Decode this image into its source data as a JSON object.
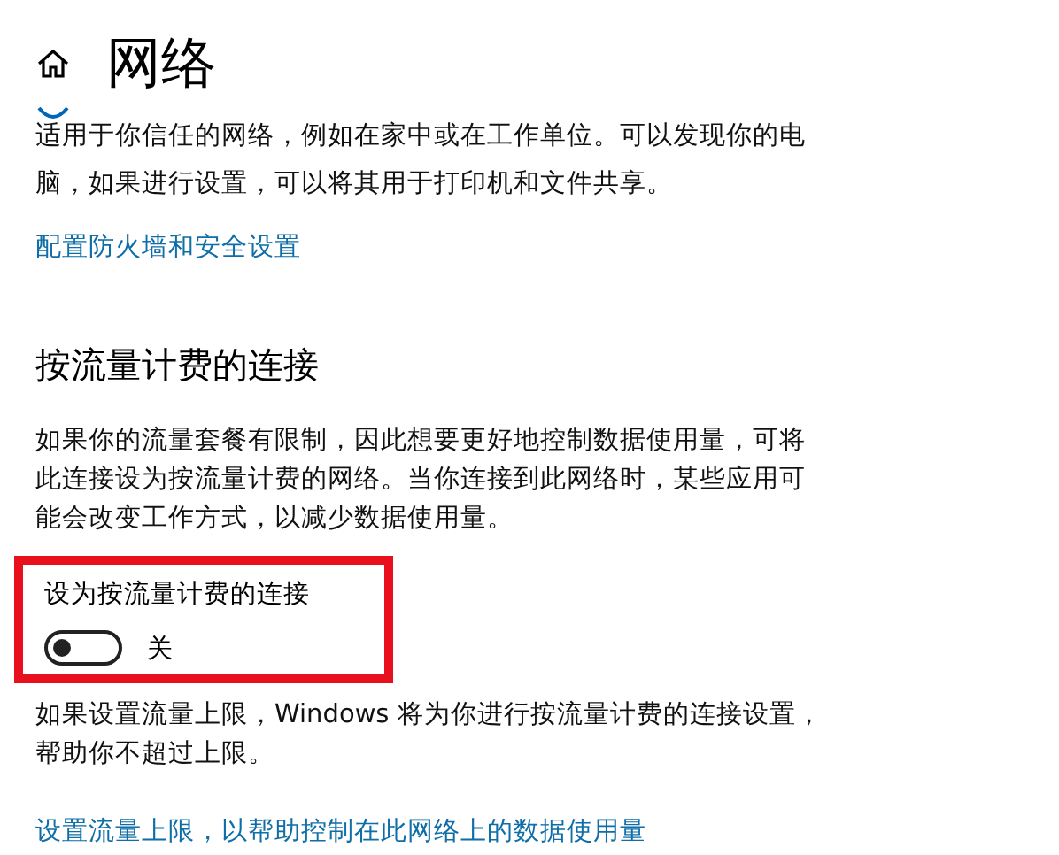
{
  "header": {
    "title": "网络"
  },
  "network_profile": {
    "radio_selected": true,
    "description": "适用于你信任的网络，例如在家中或在工作单位。可以发现你的电脑，如果进行设置，可以将其用于打印机和文件共享。",
    "link": "配置防火墙和安全设置"
  },
  "metered": {
    "heading": "按流量计费的连接",
    "description": "如果你的流量套餐有限制，因此想要更好地控制数据使用量，可将此连接设为按流量计费的网络。当你连接到此网络时，某些应用可能会改变工作方式，以减少数据使用量。",
    "setting": {
      "label": "设为按流量计费的连接",
      "on": false,
      "state_text": "关",
      "highlighted": true
    },
    "note": "如果设置流量上限，Windows 将为你进行按流量计费的连接设置，帮助你不超过上限。",
    "link": "设置流量上限，以帮助控制在此网络上的数据使用量"
  }
}
